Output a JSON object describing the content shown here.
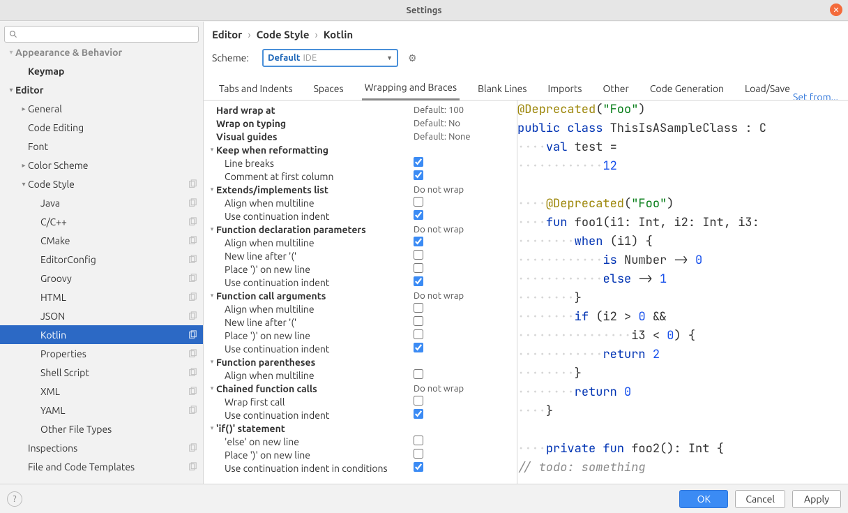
{
  "window": {
    "title": "Settings"
  },
  "breadcrumb": [
    "Editor",
    "Code Style",
    "Kotlin"
  ],
  "scheme": {
    "label": "Scheme:",
    "name": "Default",
    "tag": "IDE"
  },
  "set_from": "Set from...",
  "tree": [
    {
      "lvl": 0,
      "arrow": "▾",
      "bold": true,
      "label": "Appearance & Behavior",
      "copy": false,
      "dim": true
    },
    {
      "lvl": 1,
      "arrow": "",
      "bold": true,
      "label": "Keymap",
      "copy": false
    },
    {
      "lvl": 0,
      "arrow": "▾",
      "bold": true,
      "label": "Editor",
      "copy": false
    },
    {
      "lvl": 1,
      "arrow": "▸",
      "bold": false,
      "label": "General",
      "copy": false
    },
    {
      "lvl": 1,
      "arrow": "",
      "bold": false,
      "label": "Code Editing",
      "copy": false
    },
    {
      "lvl": 1,
      "arrow": "",
      "bold": false,
      "label": "Font",
      "copy": false
    },
    {
      "lvl": 1,
      "arrow": "▸",
      "bold": false,
      "label": "Color Scheme",
      "copy": false
    },
    {
      "lvl": 1,
      "arrow": "▾",
      "bold": false,
      "label": "Code Style",
      "copy": true
    },
    {
      "lvl": 2,
      "arrow": "",
      "bold": false,
      "label": "Java",
      "copy": true
    },
    {
      "lvl": 2,
      "arrow": "",
      "bold": false,
      "label": "C/C++",
      "copy": true
    },
    {
      "lvl": 2,
      "arrow": "",
      "bold": false,
      "label": "CMake",
      "copy": true
    },
    {
      "lvl": 2,
      "arrow": "",
      "bold": false,
      "label": "EditorConfig",
      "copy": true
    },
    {
      "lvl": 2,
      "arrow": "",
      "bold": false,
      "label": "Groovy",
      "copy": true
    },
    {
      "lvl": 2,
      "arrow": "",
      "bold": false,
      "label": "HTML",
      "copy": true
    },
    {
      "lvl": 2,
      "arrow": "",
      "bold": false,
      "label": "JSON",
      "copy": true
    },
    {
      "lvl": 2,
      "arrow": "",
      "bold": false,
      "label": "Kotlin",
      "copy": true,
      "selected": true
    },
    {
      "lvl": 2,
      "arrow": "",
      "bold": false,
      "label": "Properties",
      "copy": true
    },
    {
      "lvl": 2,
      "arrow": "",
      "bold": false,
      "label": "Shell Script",
      "copy": true
    },
    {
      "lvl": 2,
      "arrow": "",
      "bold": false,
      "label": "XML",
      "copy": true
    },
    {
      "lvl": 2,
      "arrow": "",
      "bold": false,
      "label": "YAML",
      "copy": true
    },
    {
      "lvl": 2,
      "arrow": "",
      "bold": false,
      "label": "Other File Types",
      "copy": false
    },
    {
      "lvl": 1,
      "arrow": "",
      "bold": false,
      "label": "Inspections",
      "copy": true
    },
    {
      "lvl": 1,
      "arrow": "",
      "bold": false,
      "label": "File and Code Templates",
      "copy": true
    }
  ],
  "tabs": [
    "Tabs and Indents",
    "Spaces",
    "Wrapping and Braces",
    "Blank Lines",
    "Imports",
    "Other",
    "Code Generation",
    "Load/Save"
  ],
  "active_tab": 2,
  "options": [
    {
      "type": "group",
      "label": "Hard wrap at",
      "ctrl": "text",
      "value": "Default: 100",
      "arrow": ""
    },
    {
      "type": "group",
      "label": "Wrap on typing",
      "ctrl": "text",
      "value": "Default: No",
      "arrow": ""
    },
    {
      "type": "group",
      "label": "Visual guides",
      "ctrl": "text",
      "value": "Default: None",
      "arrow": ""
    },
    {
      "type": "group",
      "label": "Keep when reformatting",
      "arrow": "▾"
    },
    {
      "type": "child",
      "label": "Line breaks",
      "ctrl": "check",
      "value": true
    },
    {
      "type": "child",
      "label": "Comment at first column",
      "ctrl": "check",
      "value": true
    },
    {
      "type": "group",
      "label": "Extends/implements list",
      "ctrl": "text",
      "value": "Do not wrap",
      "arrow": "▾"
    },
    {
      "type": "child",
      "label": "Align when multiline",
      "ctrl": "check",
      "value": false
    },
    {
      "type": "child",
      "label": "Use continuation indent",
      "ctrl": "check",
      "value": true
    },
    {
      "type": "group",
      "label": "Function declaration parameters",
      "ctrl": "text",
      "value": "Do not wrap",
      "arrow": "▾"
    },
    {
      "type": "child",
      "label": "Align when multiline",
      "ctrl": "check",
      "value": true
    },
    {
      "type": "child",
      "label": "New line after '('",
      "ctrl": "check",
      "value": false
    },
    {
      "type": "child",
      "label": "Place ')' on new line",
      "ctrl": "check",
      "value": false
    },
    {
      "type": "child",
      "label": "Use continuation indent",
      "ctrl": "check",
      "value": true
    },
    {
      "type": "group",
      "label": "Function call arguments",
      "ctrl": "text",
      "value": "Do not wrap",
      "arrow": "▾"
    },
    {
      "type": "child",
      "label": "Align when multiline",
      "ctrl": "check",
      "value": false
    },
    {
      "type": "child",
      "label": "New line after '('",
      "ctrl": "check",
      "value": false
    },
    {
      "type": "child",
      "label": "Place ')' on new line",
      "ctrl": "check",
      "value": false
    },
    {
      "type": "child",
      "label": "Use continuation indent",
      "ctrl": "check",
      "value": true
    },
    {
      "type": "group",
      "label": "Function parentheses",
      "arrow": "▾"
    },
    {
      "type": "child",
      "label": "Align when multiline",
      "ctrl": "check",
      "value": false
    },
    {
      "type": "group",
      "label": "Chained function calls",
      "ctrl": "text",
      "value": "Do not wrap",
      "arrow": "▾"
    },
    {
      "type": "child",
      "label": "Wrap first call",
      "ctrl": "check",
      "value": false
    },
    {
      "type": "child",
      "label": "Use continuation indent",
      "ctrl": "check",
      "value": true
    },
    {
      "type": "group",
      "label": "'if()' statement",
      "arrow": "▾"
    },
    {
      "type": "child",
      "label": "'else' on new line",
      "ctrl": "check",
      "value": false
    },
    {
      "type": "child",
      "label": "Place ')' on new line",
      "ctrl": "check",
      "value": false
    },
    {
      "type": "child",
      "label": "Use continuation indent in conditions",
      "ctrl": "check",
      "value": true
    }
  ],
  "preview_lines": [
    [
      {
        "t": "@Deprecated",
        "c": "ann"
      },
      {
        "t": "(",
        "c": ""
      },
      {
        "t": "\"Foo\"",
        "c": "str"
      },
      {
        "t": ")",
        "c": ""
      }
    ],
    [
      {
        "t": "public ",
        "c": "kw"
      },
      {
        "t": "class ",
        "c": "kw"
      },
      {
        "t": "ThisIsASampleClass : C",
        "c": ""
      }
    ],
    [
      {
        "t": "····",
        "c": "ws"
      },
      {
        "t": "val ",
        "c": "kw"
      },
      {
        "t": "test =",
        "c": ""
      }
    ],
    [
      {
        "t": "············",
        "c": "ws"
      },
      {
        "t": "12",
        "c": "num"
      }
    ],
    [
      {
        "t": "",
        "c": ""
      }
    ],
    [
      {
        "t": "····",
        "c": "ws"
      },
      {
        "t": "@Deprecated",
        "c": "ann"
      },
      {
        "t": "(",
        "c": ""
      },
      {
        "t": "\"Foo\"",
        "c": "str"
      },
      {
        "t": ")",
        "c": ""
      }
    ],
    [
      {
        "t": "····",
        "c": "ws"
      },
      {
        "t": "fun ",
        "c": "kw"
      },
      {
        "t": "foo1(i1: Int, i2: Int, i3:",
        "c": ""
      }
    ],
    [
      {
        "t": "········",
        "c": "ws"
      },
      {
        "t": "when ",
        "c": "kw"
      },
      {
        "t": "(i1) {",
        "c": ""
      }
    ],
    [
      {
        "t": "············",
        "c": "ws"
      },
      {
        "t": "is ",
        "c": "kw"
      },
      {
        "t": "Number -> ",
        "c": ""
      },
      {
        "t": "0",
        "c": "num"
      }
    ],
    [
      {
        "t": "············",
        "c": "ws"
      },
      {
        "t": "else ",
        "c": "kw"
      },
      {
        "t": "-> ",
        "c": ""
      },
      {
        "t": "1",
        "c": "num"
      }
    ],
    [
      {
        "t": "········",
        "c": "ws"
      },
      {
        "t": "}",
        "c": ""
      }
    ],
    [
      {
        "t": "········",
        "c": "ws"
      },
      {
        "t": "if ",
        "c": "kw"
      },
      {
        "t": "(i2 > ",
        "c": ""
      },
      {
        "t": "0",
        "c": "num"
      },
      {
        "t": " &&",
        "c": ""
      }
    ],
    [
      {
        "t": "················",
        "c": "ws"
      },
      {
        "t": "i3 < ",
        "c": ""
      },
      {
        "t": "0",
        "c": "num"
      },
      {
        "t": ") {",
        "c": ""
      }
    ],
    [
      {
        "t": "············",
        "c": "ws"
      },
      {
        "t": "return ",
        "c": "kw"
      },
      {
        "t": "2",
        "c": "num"
      }
    ],
    [
      {
        "t": "········",
        "c": "ws"
      },
      {
        "t": "}",
        "c": ""
      }
    ],
    [
      {
        "t": "········",
        "c": "ws"
      },
      {
        "t": "return ",
        "c": "kw"
      },
      {
        "t": "0",
        "c": "num"
      }
    ],
    [
      {
        "t": "····",
        "c": "ws"
      },
      {
        "t": "}",
        "c": ""
      }
    ],
    [
      {
        "t": "",
        "c": ""
      }
    ],
    [
      {
        "t": "····",
        "c": "ws"
      },
      {
        "t": "private ",
        "c": "kw"
      },
      {
        "t": "fun ",
        "c": "kw"
      },
      {
        "t": "foo2(): Int {",
        "c": ""
      }
    ],
    [
      {
        "t": "// todo: something",
        "c": "cmt"
      }
    ]
  ],
  "footer": {
    "ok": "OK",
    "cancel": "Cancel",
    "apply": "Apply"
  }
}
